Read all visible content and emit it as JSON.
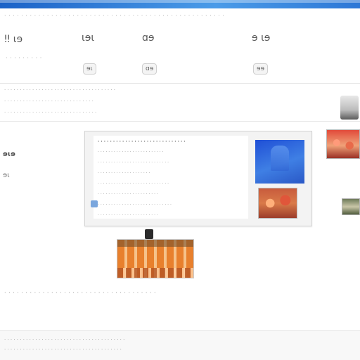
{
  "header": {
    "glyphs": [
      {
        "id": "g1",
        "text": "ǃǃ ɩɘ"
      },
      {
        "id": "g2",
        "text": "ɩɘɩ"
      },
      {
        "id": "g3",
        "text": "ɑɘ"
      },
      {
        "id": "g4",
        "text": "ɘ ɩɘ"
      }
    ],
    "chips": [
      {
        "id": "c1",
        "text": "ɘɩ"
      },
      {
        "id": "c2",
        "text": "ɑɘ"
      },
      {
        "id": "c3",
        "text": "ɘɘ"
      }
    ]
  },
  "strip": {
    "lines": [
      "· · ·  ·  · · · · ·  ·  ·  ·  ·  · · · · ·  ·  · · ·  ·  · · ·  ·  ·  · · · ·  ·  · · ·",
      "· · ·   · ·  ·   ·   · · ·   ·  ·  ·  ·  ·   · ·  ·   ·   · · ·   ·  ·  ·  ·  ·   · ·",
      "· ·  · · ·   ·   · · ·   ·  ·  · · ·   ·   · ·  · · ·   ·   · · ·   ·  ·  · · ·   ·"
    ]
  },
  "left": {
    "label1": "ɘɩɘ",
    "label2": "ɘɩ"
  },
  "panel": {
    "lines": [
      {
        "text": "· · · · · · · · · · · · · · · · · · · · · · · · · · · · ·",
        "bold": true
      },
      {
        "text": "· · · · · · · · · · · · · · · · · · · · · · · · ·",
        "bold": false
      },
      {
        "text": "· · · · · · · · · · · · · · · · · · · · · · · · · · ·",
        "bold": false
      },
      {
        "text": "· · · · · · · · · · · · · · · · · · · ·",
        "bold": false
      },
      {
        "text": "· · · · · · · · · · · · · · · · · · · · · · · · · · ·",
        "bold": false
      },
      {
        "text": "· · · · · · · · · · · · · · · · · · · · · · ·",
        "bold": false
      },
      {
        "text": "· · · · · · · · · · · · · · · · · · · · · · · · · · · ·",
        "bold": false
      },
      {
        "text": "· · · · · · · · · · · · · · · · · · · · · · ·",
        "bold": false
      }
    ]
  },
  "caption": {
    "text": "· · ·  · · · · ·  · · · ·  · · ·  · · · ·  · · ·  · · · · ·  · · · ·  · · · · ·"
  },
  "footer": {
    "lines": [
      "· · ·  · · · · ·  · · · ·  · · ·  · · · ·  · · ·  · · · · ·  · · · ·  · · · · ·  · · ·",
      "· · · · ·  · · ·  · · · · ·  · · ·  · · ·  · · · ·  · · ·  · · · · ·  · · ·  · · · ·"
    ]
  },
  "colors": {
    "accent": "#2d77d6",
    "panel_bg": "#f3f3f3"
  }
}
